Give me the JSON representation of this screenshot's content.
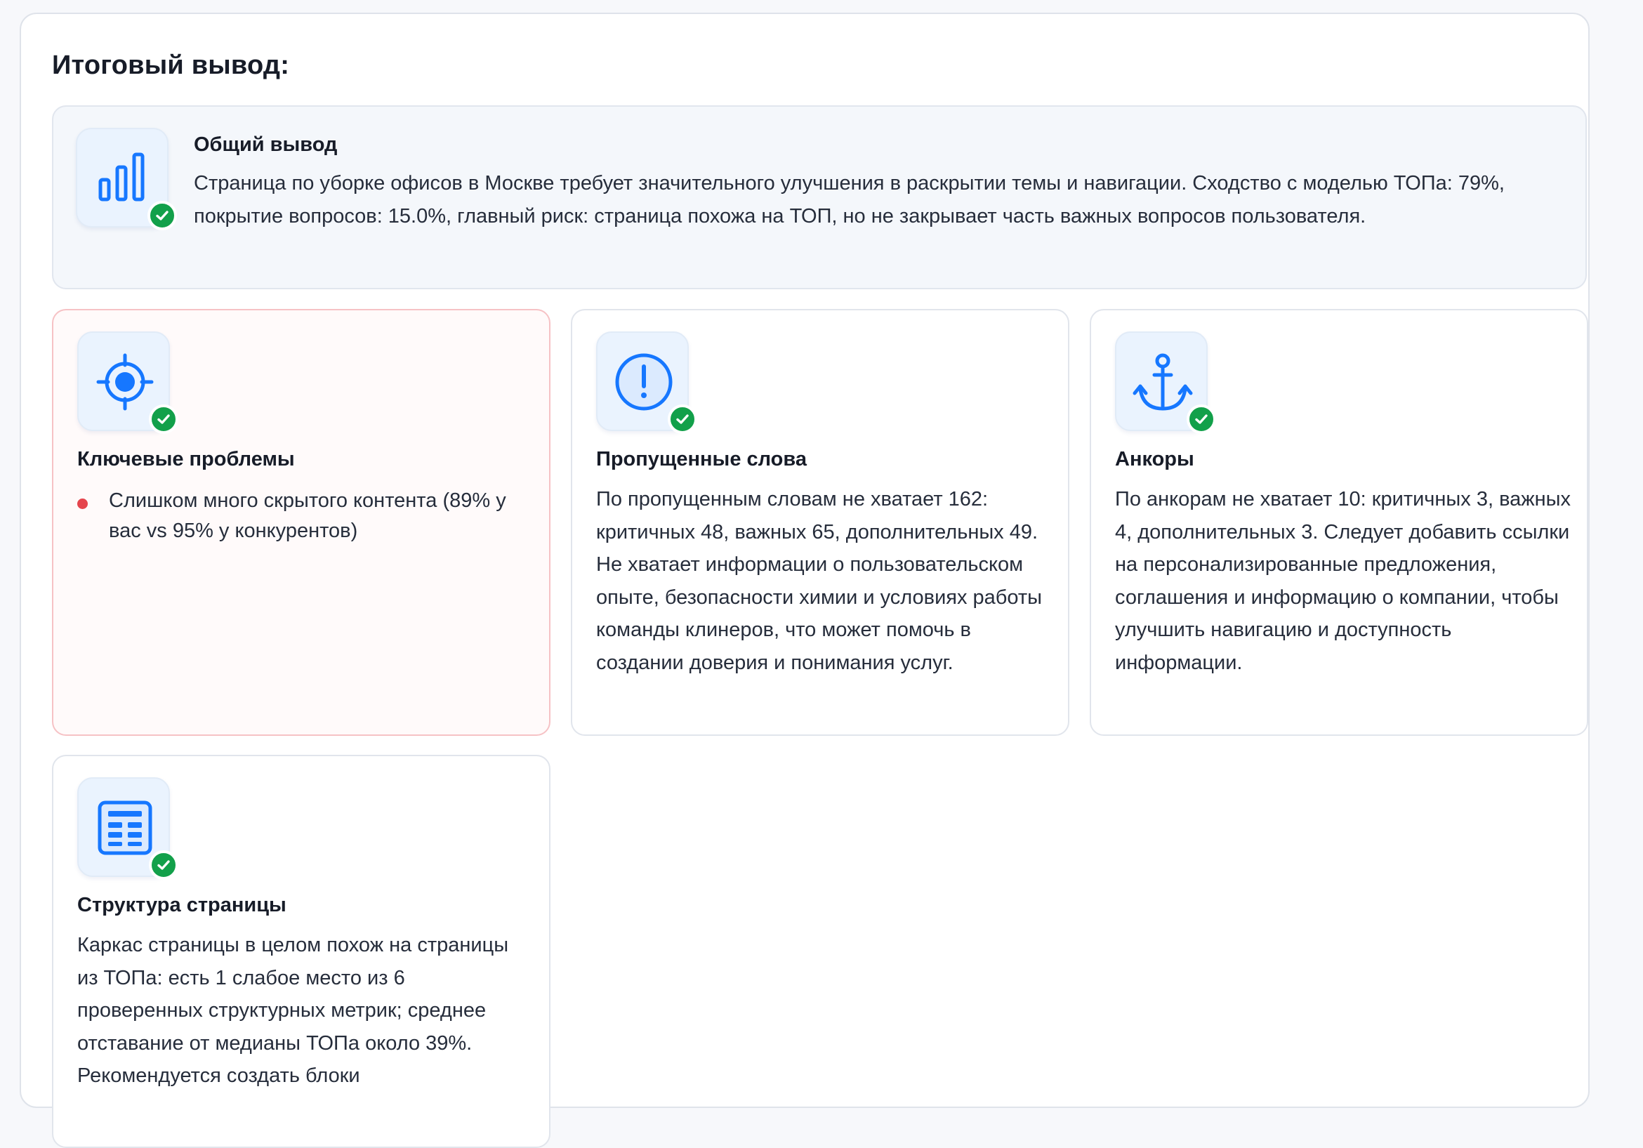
{
  "section_title": "Итоговый вывод:",
  "summary": {
    "title": "Общий вывод",
    "icon": "bar-chart-icon",
    "text": "Страница по уборке офисов в Москве требует значительного улучшения в раскрытии темы и навигации. Сходство с моделью ТОПа: 79%, покрытие вопросов: 15.0%, главный риск: страница похожа на ТОП, но не закрывает часть важных вопросов пользователя."
  },
  "cards": {
    "problems": {
      "title": "Ключевые проблемы",
      "icon": "target-icon",
      "items": [
        "Слишком много скрытого контента (89% у вас vs 95% у конкурентов)"
      ]
    },
    "missing_words": {
      "title": "Пропущенные слова",
      "icon": "alert-circle-icon",
      "text": "По пропущенным словам не хватает 162: критичных 48, важных 65, дополнительных 49. Не хватает информации о пользовательском опыте, безопасности химии и условиях работы команды клинеров, что может помочь в создании доверия и понимания услуг."
    },
    "anchors": {
      "title": "Анкоры",
      "icon": "anchor-icon",
      "text": "По анкорам не хватает 10: критичных 3, важных 4, дополнительных 3. Следует добавить ссылки на персонализированные предложения, соглашения и информацию о компании, чтобы улучшить навигацию и доступность информации."
    },
    "structure": {
      "title": "Структура страницы",
      "icon": "document-layout-icon",
      "text": "Каркас страницы в целом похож на страницы из ТОПа: есть 1 слабое место из 6 проверенных структурных метрик; среднее отставание от медианы ТОПа около 39%. Рекомендуется создать блоки"
    }
  },
  "colors": {
    "accent": "#1677ff",
    "success": "#12a04a",
    "danger": "#e5454d"
  }
}
